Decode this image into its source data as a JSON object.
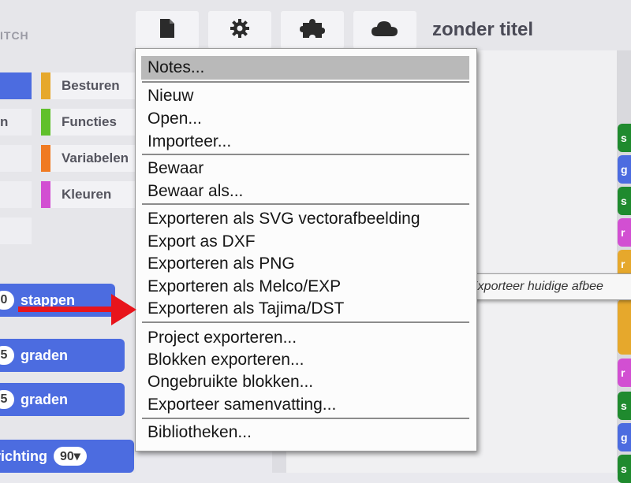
{
  "header": {
    "logo_text": "ITCH",
    "project_title": "zonder titel",
    "buttons": [
      {
        "icon": "file-icon"
      },
      {
        "icon": "gear-icon"
      },
      {
        "icon": "puzzle-icon"
      },
      {
        "icon": "cloud-icon"
      }
    ]
  },
  "palette": {
    "categories_left": [
      {
        "label": "",
        "color": "#4c6ce0"
      },
      {
        "label": "n",
        "color": ""
      },
      {
        "label": "",
        "color": ""
      },
      {
        "label": "",
        "color": ""
      },
      {
        "label": "",
        "color": ""
      }
    ],
    "categories_right": [
      {
        "label": "Besturen",
        "color": "#e6a82c"
      },
      {
        "label": "Functies",
        "color": "#61c02c"
      },
      {
        "label": "Variabelen",
        "color": "#f07a22"
      },
      {
        "label": "Kleuren",
        "color": "#d24fd2"
      }
    ],
    "blocks": [
      {
        "pill": "0",
        "text": "stappen"
      },
      {
        "pill": "5",
        "text": "graden"
      },
      {
        "pill": "5",
        "text": "graden"
      },
      {
        "text": "richting",
        "dropdown": "90▾"
      }
    ]
  },
  "file_menu": {
    "items": [
      {
        "label": "Notes...",
        "highlighted": true
      },
      {
        "label": "Nieuw"
      },
      {
        "label": "Open..."
      },
      {
        "label": "Importeer..."
      },
      {
        "label": "Bewaar"
      },
      {
        "label": "Bewaar als..."
      },
      {
        "label": "Exporteren als SVG vectorafbeelding"
      },
      {
        "label": "Export as DXF"
      },
      {
        "label": "Exporteren als PNG"
      },
      {
        "label": "Exporteren als Melco/EXP"
      },
      {
        "label": "Exporteren als Tajima/DST"
      },
      {
        "label": "Project exporteren..."
      },
      {
        "label": "Blokken exporteren..."
      },
      {
        "label": "Ongebruikte blokken..."
      },
      {
        "label": "Exporteer samenvatting..."
      },
      {
        "label": "Bibliotheken..."
      }
    ]
  },
  "tooltip": {
    "text": "Exporteer huidige afbee"
  },
  "right_strip_blocks": [
    {
      "label": "s",
      "color": "#1f8a2e"
    },
    {
      "label": "g",
      "color": "#4c6ce0"
    },
    {
      "label": "s",
      "color": "#1f8a2e"
    },
    {
      "label": "r",
      "color": "#d24fd2"
    },
    {
      "label": "r",
      "color": "#e6a82c"
    },
    {
      "label": "",
      "color": "#e6a82c"
    },
    {
      "label": "r",
      "color": "#d24fd2"
    },
    {
      "label": "s",
      "color": "#1f8a2e"
    },
    {
      "label": "g",
      "color": "#4c6ce0"
    },
    {
      "label": "s",
      "color": "#1f8a2e"
    }
  ],
  "colors": {
    "annotation_arrow": "#e8141b",
    "menu_highlight": "#b9b9b9"
  }
}
